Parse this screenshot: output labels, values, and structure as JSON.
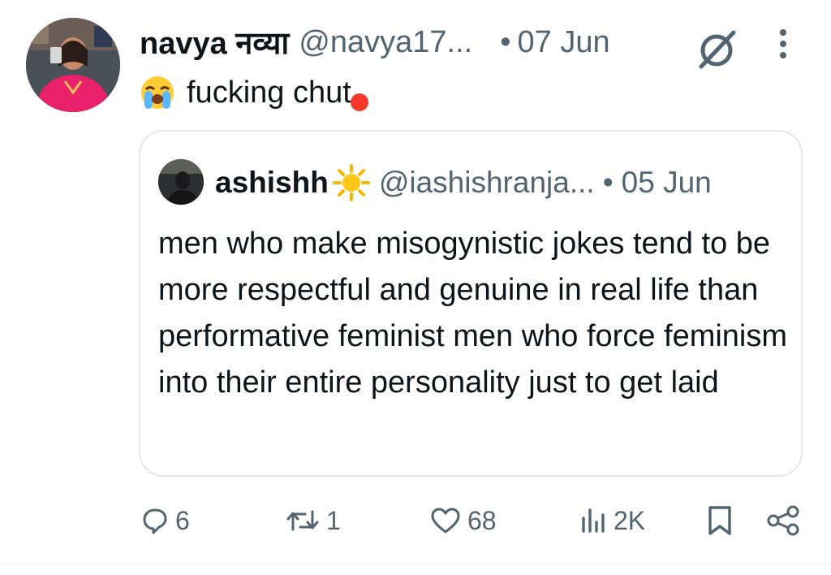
{
  "tweet": {
    "author_name": "navya नव्या",
    "author_handle": "@navya17...",
    "separator": "•",
    "date": "07 Jun",
    "text": "fucking chut",
    "emoji": "loudly-crying-face"
  },
  "quoted_tweet": {
    "author_name": "ashishh",
    "author_badge_emoji": "sun",
    "author_handle": "@iashishranja...",
    "separator": "•",
    "date": "05 Jun",
    "text": "men who make misogynistic jokes tend to be more respectful and genuine in real life than performative feminist men who force feminism into their entire personality just to get laid"
  },
  "actions": {
    "replies": "6",
    "reposts": "1",
    "likes": "68",
    "views": "2K"
  },
  "colors": {
    "text_primary": "#0f1419",
    "text_secondary": "#536471",
    "border": "#e4e8eb",
    "red_dot": "#f4382c"
  },
  "icons": [
    "grok-icon",
    "more-vertical-icon",
    "reply-icon",
    "repost-icon",
    "like-icon",
    "views-icon",
    "bookmark-icon",
    "share-icon"
  ]
}
